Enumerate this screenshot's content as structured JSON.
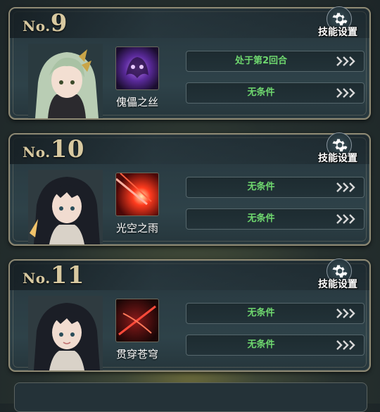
{
  "skill_settings_label": "技能设置",
  "cards": [
    {
      "no_prefix": "No.",
      "number": "9",
      "skill_name": "傀儡之丝",
      "conditions": [
        "处于第2回合",
        "无条件"
      ]
    },
    {
      "no_prefix": "No.",
      "number": "10",
      "skill_name": "光空之雨",
      "conditions": [
        "无条件",
        "无条件"
      ]
    },
    {
      "no_prefix": "No.",
      "number": "11",
      "skill_name": "贯穿苍穹",
      "conditions": [
        "无条件",
        "无条件"
      ]
    }
  ],
  "colors": {
    "condition_text": "#6fd86f",
    "title_gold": "#d8c9a0",
    "frame": "#8f8a74"
  }
}
